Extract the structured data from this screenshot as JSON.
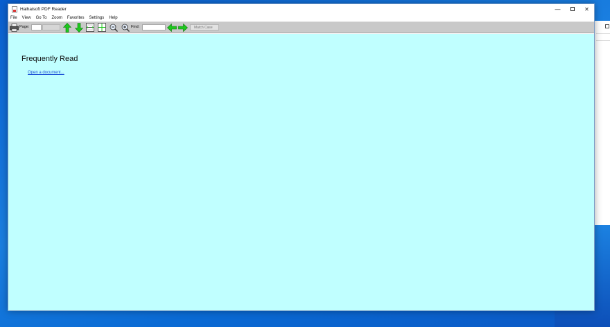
{
  "window": {
    "title": "Haihaisoft PDF Reader",
    "controls": {
      "minimize": "—",
      "close": "✕"
    }
  },
  "menu": {
    "items": [
      "File",
      "View",
      "Go To",
      "Zoom",
      "Favorites",
      "Settings",
      "Help"
    ]
  },
  "toolbar": {
    "page_label": "Page:",
    "find_label": "Find:",
    "match_case_label": "Match Case",
    "icons": [
      "printer-icon",
      "previous-page-arrow-up-icon",
      "next-page-arrow-down-icon",
      "fit-width-icon",
      "fit-page-icon",
      "zoom-out-icon",
      "zoom-in-icon",
      "find-previous-arrow-left-icon",
      "find-next-arrow-right-icon"
    ]
  },
  "content": {
    "heading": "Frequently Read",
    "open_link": "Open a document..."
  },
  "colors": {
    "content_background": "#c0ffff",
    "toolbar_background": "#c9c9c9",
    "arrow_green": "#1ec81e",
    "link": "#1a4fd6"
  }
}
